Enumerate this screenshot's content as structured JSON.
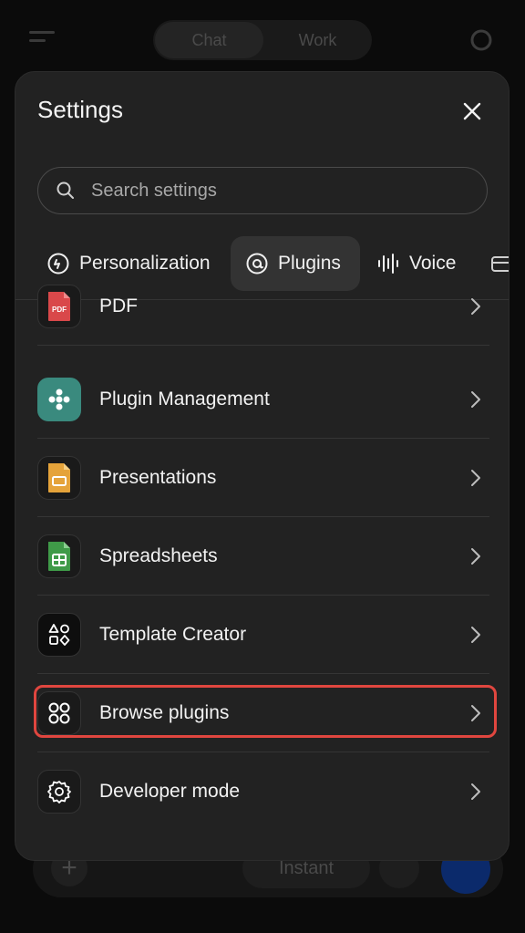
{
  "background": {
    "tabs": [
      "Chat",
      "Work"
    ],
    "bottom": {
      "mode": "Instant"
    }
  },
  "settings": {
    "title": "Settings",
    "search": {
      "placeholder": "Search settings",
      "value": ""
    },
    "tabs": [
      {
        "label": "Personalization",
        "icon": "personalization-icon"
      },
      {
        "label": "Plugins",
        "icon": "plugins-icon",
        "active": true
      },
      {
        "label": "Voice",
        "icon": "voice-waveform-icon"
      }
    ],
    "plugins": [
      {
        "label": "PDF",
        "icon": "pdf-icon",
        "badge": "PDF"
      },
      {
        "label": "Plugin Management",
        "icon": "plugin-management-icon"
      },
      {
        "label": "Presentations",
        "icon": "presentations-icon"
      },
      {
        "label": "Spreadsheets",
        "icon": "spreadsheets-icon"
      },
      {
        "label": "Template Creator",
        "icon": "template-creator-icon"
      },
      {
        "label": "Browse plugins",
        "icon": "browse-plugins-icon",
        "highlighted": true
      },
      {
        "label": "Developer mode",
        "icon": "gear-icon"
      }
    ]
  },
  "colors": {
    "modal_bg": "#222222",
    "highlight": "#e0463f",
    "pdf_red": "#d9484a",
    "plugin_teal": "#3a8a7e",
    "presentation_orange": "#e5a33a",
    "spreadsheet_green": "#3f9a48"
  }
}
